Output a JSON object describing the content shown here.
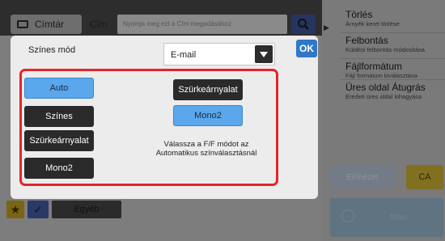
{
  "header": {
    "cimtar_label": "Címtár",
    "cim_label": "Cím",
    "search_placeholder": "Nyomja meg ezt a Cím megadásához"
  },
  "sidebar": {
    "items": [
      {
        "title": "Törlés",
        "subtitle": "Árnyék keret törlése"
      },
      {
        "title": "Felbontás",
        "subtitle": "Küldési felbontás módosítása"
      },
      {
        "title": "Fájlformátum",
        "subtitle": "Fájl formátum kiválasztása"
      },
      {
        "title": "Üres oldal Átugrás",
        "subtitle": "Eredeti üres oldal kihagyása"
      }
    ],
    "preview_label": "Előnézet",
    "ca_label": "CA",
    "start_label": "Start"
  },
  "bottom": {
    "other_label": "Egyéb"
  },
  "dialog": {
    "title": "Színes mód",
    "select_value": "E-mail",
    "ok_label": "OK",
    "left_options": [
      "Auto",
      "Színes",
      "Szürkeárnyalat",
      "Mono2"
    ],
    "selected_left": "Auto",
    "right_options": [
      "Szürkeárnyalat",
      "Mono2"
    ],
    "selected_right": "Mono2",
    "note_line1": "Válassza a F/F módot az",
    "note_line2": "Automatikus színválasztásnál"
  },
  "colors": {
    "highlight": "#e3242b",
    "selected": "#5aa7ec",
    "ok": "#2e78c8"
  }
}
